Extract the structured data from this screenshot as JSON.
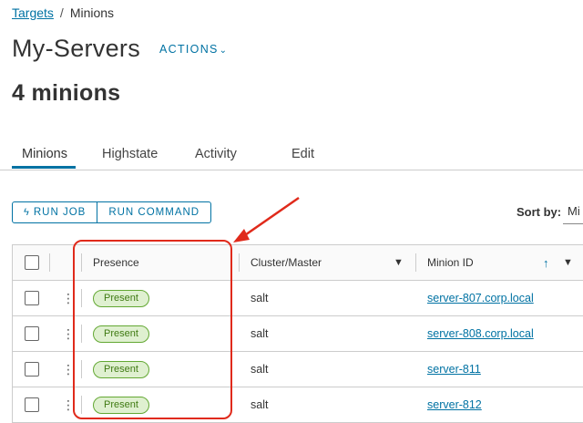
{
  "breadcrumb": {
    "parent": "Targets",
    "separator": "/",
    "current": "Minions"
  },
  "header": {
    "title": "My-Servers",
    "actions_label": "ACTIONS"
  },
  "summary": {
    "count_label": "4 minions"
  },
  "tabs": [
    {
      "label": "Minions",
      "active": true
    },
    {
      "label": "Highstate",
      "active": false
    },
    {
      "label": "Activity",
      "active": false
    },
    {
      "label": "Edit",
      "active": false
    }
  ],
  "toolbar": {
    "run_job_label": "RUN JOB",
    "run_command_label": "RUN COMMAND"
  },
  "sort": {
    "label": "Sort by:",
    "value": "Mi"
  },
  "table": {
    "columns": {
      "presence": "Presence",
      "cluster": "Cluster/Master",
      "minion_id": "Minion ID"
    },
    "rows": [
      {
        "presence": "Present",
        "cluster": "salt",
        "minion_id": "server-807.corp.local"
      },
      {
        "presence": "Present",
        "cluster": "salt",
        "minion_id": "server-808.corp.local"
      },
      {
        "presence": "Present",
        "cluster": "salt",
        "minion_id": "server-811"
      },
      {
        "presence": "Present",
        "cluster": "salt",
        "minion_id": "server-812"
      }
    ]
  },
  "icons": {
    "actions_chevron": "chevron-down-icon",
    "run_job": "bolt-icon",
    "row_menu": "vertical-ellipsis-icon",
    "filter": "filter-icon",
    "sort_asc": "arrow-up-icon"
  },
  "colors": {
    "accent": "#0072a3",
    "present_badge_bg": "#dff0d0",
    "present_badge_border": "#63a833",
    "annotation": "#e02a1b"
  }
}
